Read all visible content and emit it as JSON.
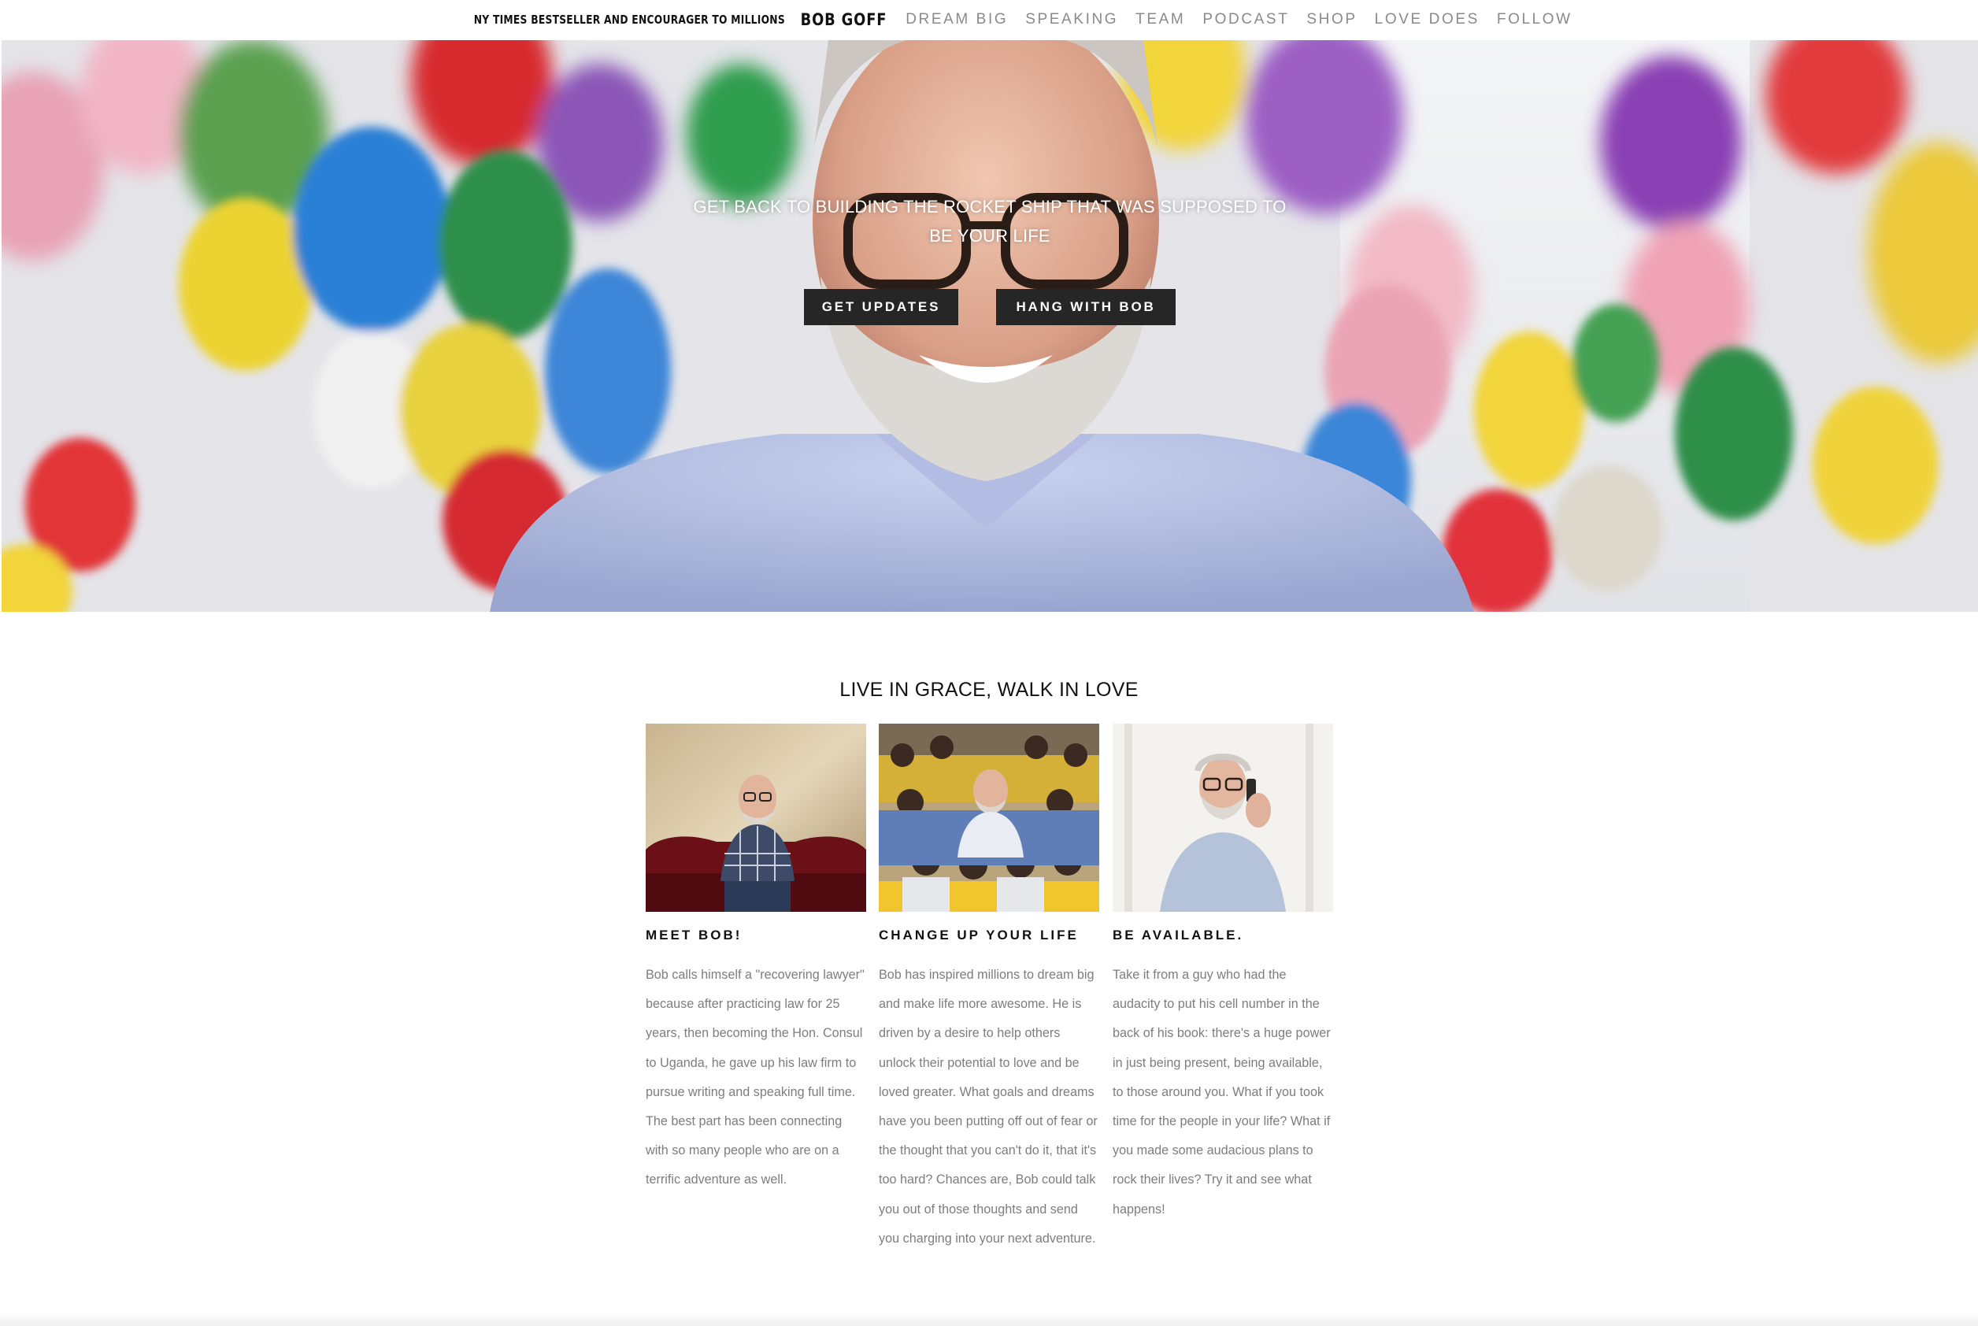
{
  "nav": {
    "tagline": "NY TIMES BESTSELLER AND ENCOURAGER TO MILLIONS",
    "brand": "BOB GOFF",
    "links": [
      "DREAM BIG",
      "SPEAKING",
      "TEAM",
      "PODCAST",
      "SHOP",
      "LOVE DOES",
      "FOLLOW"
    ]
  },
  "hero": {
    "headline": "GET BACK TO BUILDING THE ROCKET SHIP THAT WAS SUPPOSED TO BE YOUR LIFE",
    "buttons": [
      "GET UPDATES",
      "HANG WITH BOB"
    ]
  },
  "section": {
    "title": "LIVE IN GRACE, WALK IN LOVE"
  },
  "cards": [
    {
      "heading": "MEET BOB!",
      "body": "Bob calls himself a \"recovering lawyer\" because after practicing law for 25 years, then becoming the Hon. Consul to Uganda, he gave up his law firm to pursue writing and speaking full time. The best part has been connecting with so many people who are on a terrific adventure as well."
    },
    {
      "heading": "CHANGE UP YOUR LIFE",
      "body": "Bob has inspired millions to dream big and make life more awesome. He is driven by a desire to help others unlock their potential to love and be loved greater. What goals and dreams have you been putting off out of fear or the thought that you can't do it, that it's too hard? Chances are, Bob could talk you out of those thoughts and send you charging into your next adventure."
    },
    {
      "heading": "BE AVAILABLE.",
      "body": "Take it from a guy who had the audacity to put his cell number in the back of his book: there's a huge power in just being present, being available, to those around you. What if you took time for the people in your life? What if you made some audacious plans to rock their lives? Try it and see what happens!"
    }
  ],
  "colors": {
    "button_bg": "#262626",
    "nav_link": "#8a8a8a",
    "body_text": "#7d7d7d"
  }
}
